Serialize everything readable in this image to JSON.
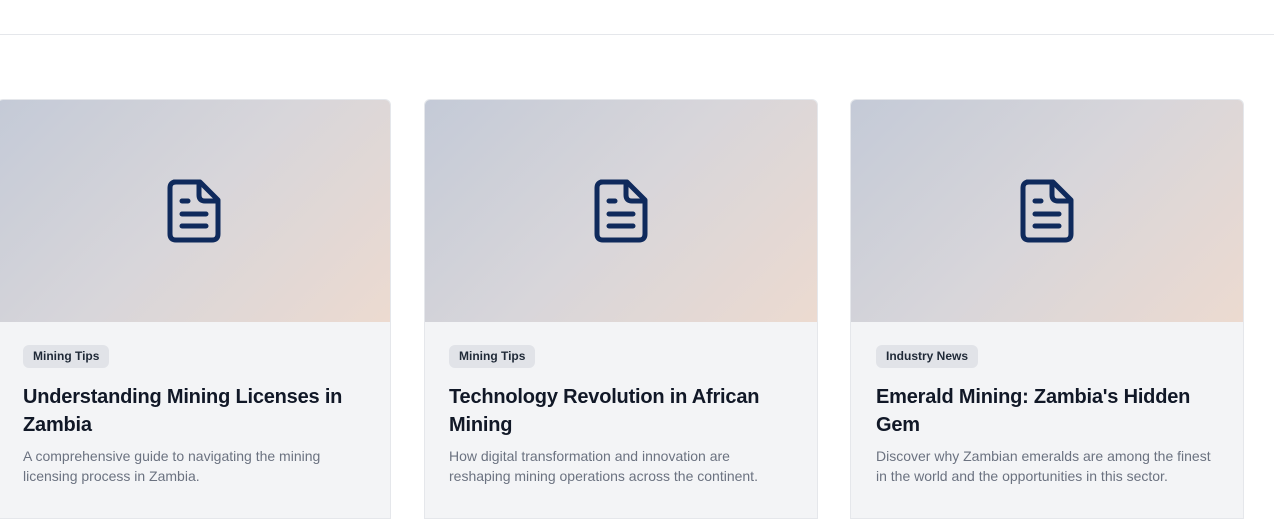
{
  "cards": [
    {
      "category": "Mining Tips",
      "title": "Understanding Mining Licenses in Zambia",
      "description": "A comprehensive guide to navigating the mining licensing process in Zambia.",
      "icon": "document-icon"
    },
    {
      "category": "Mining Tips",
      "title": "Technology Revolution in African Mining",
      "description": "How digital transformation and innovation are reshaping mining operations across the continent.",
      "icon": "document-icon"
    },
    {
      "category": "Industry News",
      "title": "Emerald Mining: Zambia's Hidden Gem",
      "description": "Discover why Zambian emeralds are among the finest in the world and the opportunities in this sector.",
      "icon": "document-icon"
    }
  ],
  "colors": {
    "icon": "#0f2a5c",
    "tag_bg": "#e1e3e8",
    "title": "#111827",
    "description": "#6b7280"
  }
}
